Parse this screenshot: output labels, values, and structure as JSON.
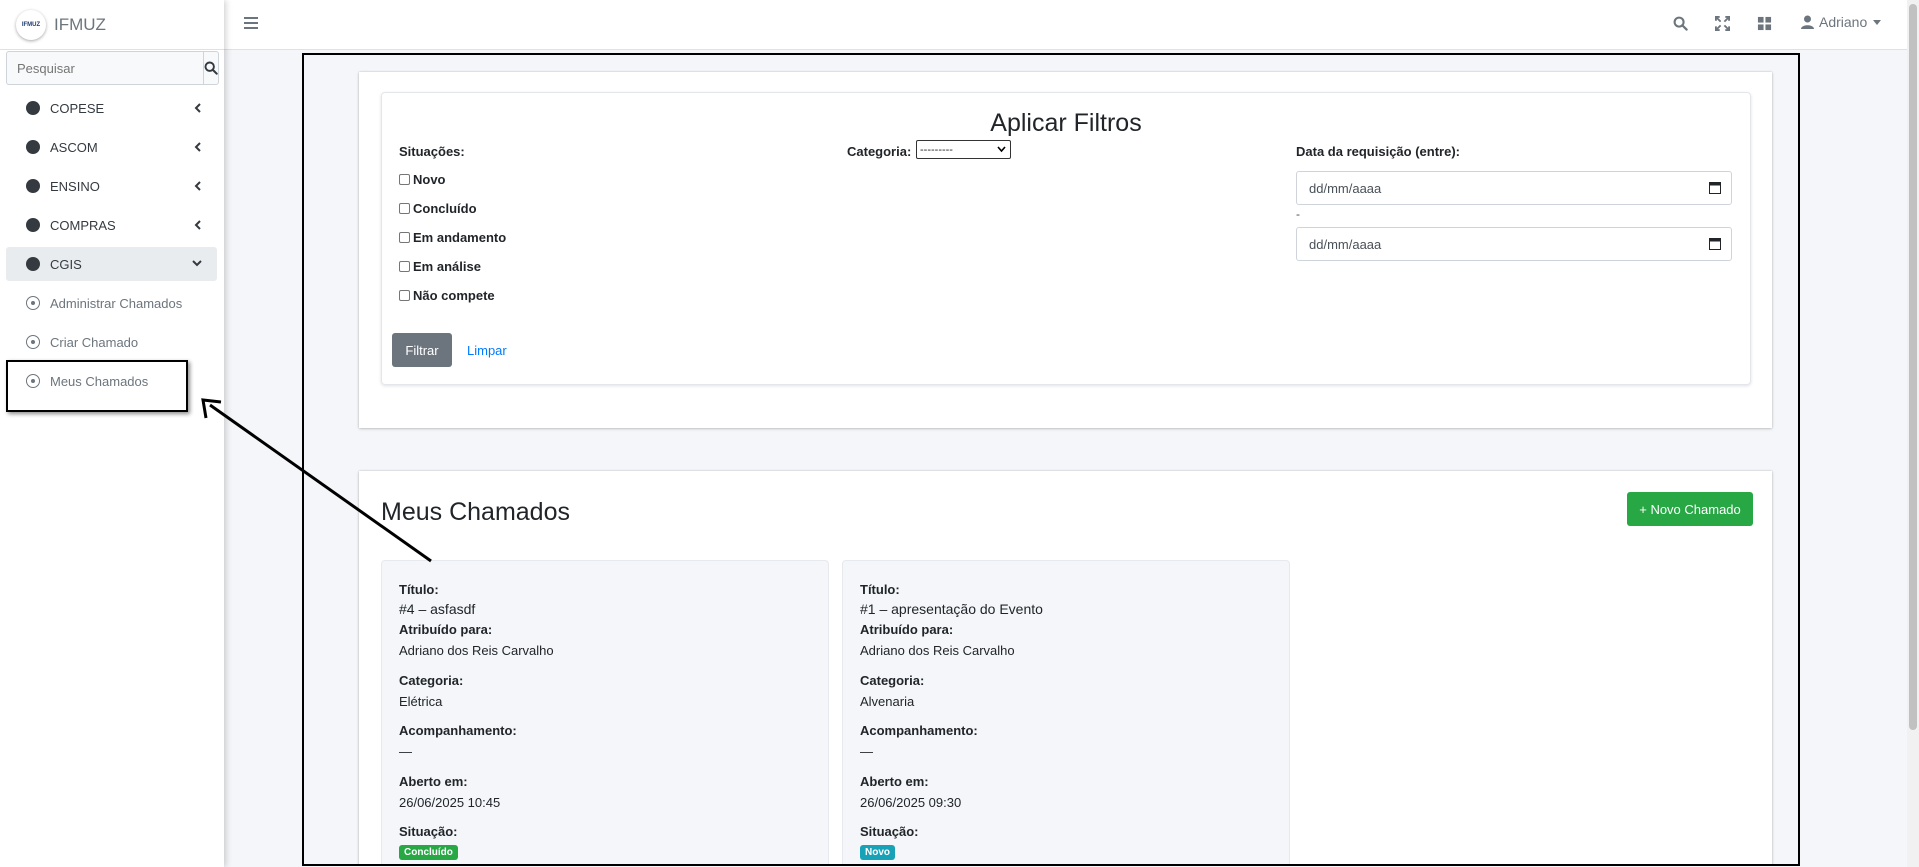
{
  "brand": {
    "name": "IFMUZ",
    "logo_text": "IFMUZ"
  },
  "search": {
    "placeholder": "Pesquisar",
    "icon": "search-icon"
  },
  "sidebar": {
    "items": [
      {
        "label": "COPESE",
        "icon": "chevron-left-icon"
      },
      {
        "label": "ASCOM",
        "icon": "chevron-left-icon"
      },
      {
        "label": "ENSINO",
        "icon": "chevron-left-icon"
      },
      {
        "label": "COMPRAS",
        "icon": "chevron-left-icon"
      },
      {
        "label": "CGIS",
        "icon": "chevron-down-icon"
      }
    ],
    "subitems": [
      {
        "label": "Administrar Chamados"
      },
      {
        "label": "Criar Chamado"
      },
      {
        "label": "Meus Chamados"
      }
    ]
  },
  "topbar": {
    "menu_icon": "hamburger-icon",
    "icons": [
      "search-icon",
      "expand-icon",
      "grid-icon"
    ],
    "user": "Adriano"
  },
  "filters": {
    "title": "Aplicar Filtros",
    "situacoes_label": "Situações:",
    "situacoes": [
      "Novo",
      "Concluído",
      "Em andamento",
      "Em análise",
      "Não compete"
    ],
    "categoria_label": "Categoria:",
    "categoria_value": "---------",
    "data_label": "Data da requisição (entre):",
    "date_placeholder_1": "dd/mm/aaaa",
    "date_separator": "-",
    "date_placeholder_2": "dd/mm/aaaa",
    "filtrar_label": "Filtrar",
    "limpar_label": "Limpar"
  },
  "list": {
    "title": "Meus Chamados",
    "new_button": "+ Novo Chamado",
    "labels": {
      "titulo": "Título:",
      "atribuido": "Atribuído para:",
      "categoria": "Categoria:",
      "acompanhamento": "Acompanhamento:",
      "aberto": "Aberto em:",
      "situacao": "Situação:"
    },
    "tickets": [
      {
        "title": "#4 – asfasdf",
        "assigned": "Adriano dos Reis Carvalho",
        "category": "Elétrica",
        "followup": "—",
        "opened": "26/06/2025 10:45",
        "status": "Concluído",
        "status_color": "#28a745"
      },
      {
        "title": "#1 – apresentação do Evento",
        "assigned": "Adriano dos Reis Carvalho",
        "category": "Alvenaria",
        "followup": "—",
        "opened": "26/06/2025 09:30",
        "status": "Novo",
        "status_color": "#17a2b8"
      }
    ]
  }
}
